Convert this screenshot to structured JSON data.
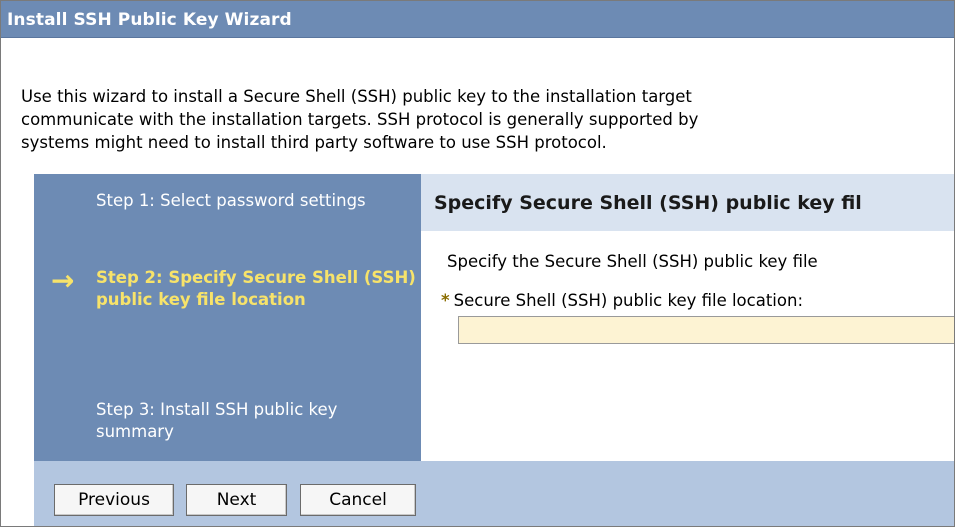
{
  "window": {
    "title": "Install SSH Public Key Wizard"
  },
  "intro": {
    "lines": [
      "Use this wizard to install a Secure Shell (SSH) public key to the installation target",
      "communicate with the installation targets. SSH protocol is generally supported by",
      "systems might need to install third party software to use SSH protocol."
    ]
  },
  "steps": {
    "current_indicator": "→",
    "items": [
      {
        "label": "Step 1: Select password settings",
        "current": false
      },
      {
        "label": "Step 2: Specify Secure Shell (SSH) public key file location",
        "current": true
      },
      {
        "label": "Step 3: Install SSH public key summary",
        "current": false
      }
    ]
  },
  "content": {
    "header": "Specify Secure Shell (SSH) public key fil",
    "description": "Specify the Secure Shell (SSH) public key file",
    "required_marker": "*",
    "field_label": "Secure Shell (SSH) public key file location:",
    "field_value": ""
  },
  "buttons": {
    "previous": "Previous",
    "next": "Next",
    "cancel": "Cancel"
  },
  "colors": {
    "titlebar": "#6d8bb4",
    "steps_panel": "#6d8bb4",
    "current_step_text": "#f7e36a",
    "content_header": "#d9e3f0",
    "input_background": "#fdf3d3",
    "footer": "#b3c6e0"
  }
}
